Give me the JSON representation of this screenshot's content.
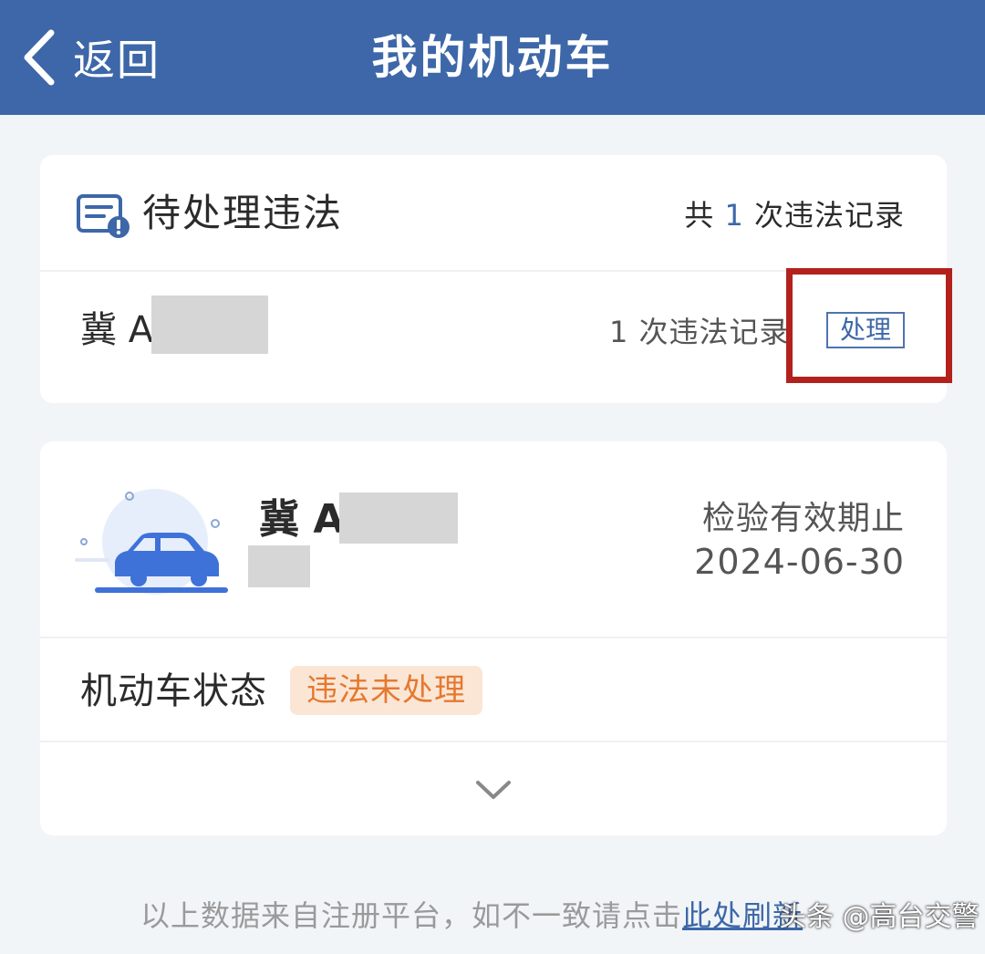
{
  "header": {
    "back_label": "返回",
    "title": "我的机动车",
    "back_icon": "chevron-left-icon"
  },
  "violations": {
    "title": "待处理违法",
    "icon": "document-alert-icon",
    "total_prefix": "共 ",
    "total_count": "1",
    "total_suffix": " 次违法记录",
    "row": {
      "plate": "冀 A(",
      "count_text": "1 次违法记录",
      "action_label": "处理"
    }
  },
  "vehicle": {
    "illustration": "car-illustration",
    "plate": "冀 A(",
    "valid_label": "检验有效期止",
    "valid_date": "2024-06-30",
    "status_label": "机动车状态",
    "status_value": "违法未处理",
    "expand_icon": "chevron-down-icon"
  },
  "footer": {
    "note": "以上数据来自注册平台，如不一致请点击",
    "link": "此处刷新"
  },
  "watermark": "头条 @高台交警",
  "colors": {
    "header_bg": "#3d67a8",
    "accent_blue": "#3d67a8",
    "status_orange": "#e5792f",
    "status_bg": "#fbe6d6",
    "highlight_red": "#b3211c"
  }
}
